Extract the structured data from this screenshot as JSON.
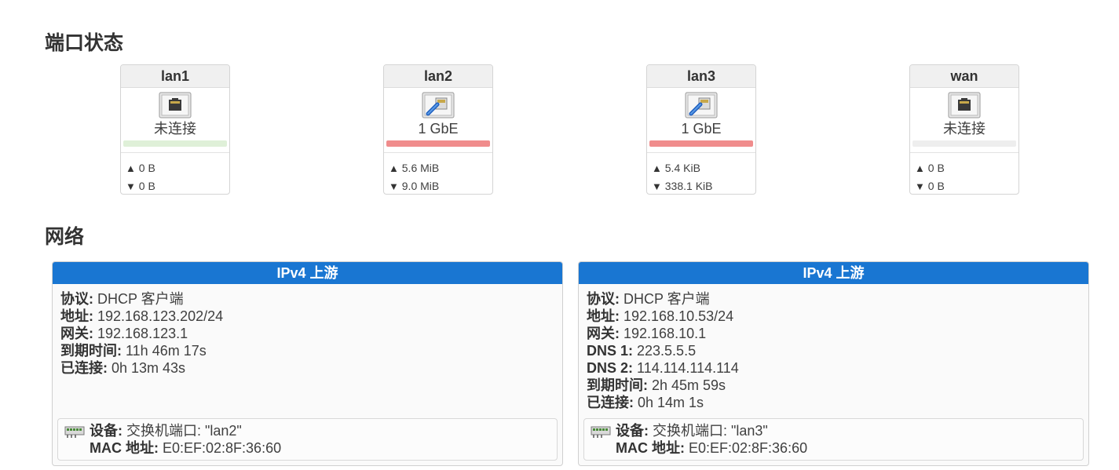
{
  "sections": {
    "port_status_title": "端口状态",
    "network_title": "网络"
  },
  "ports": [
    {
      "name": "lan1",
      "status": "未连接",
      "connected": false,
      "tx": "0 B",
      "rx": "0 B",
      "bar_color": "#dff0d8"
    },
    {
      "name": "lan2",
      "status": "1 GbE",
      "connected": true,
      "tx": "5.6 MiB",
      "rx": "9.0 MiB",
      "bar_color": "#f08c8c"
    },
    {
      "name": "lan3",
      "status": "1 GbE",
      "connected": true,
      "tx": "5.4 KiB",
      "rx": "338.1 KiB",
      "bar_color": "#f08c8c"
    },
    {
      "name": "wan",
      "status": "未连接",
      "connected": false,
      "tx": "0 B",
      "rx": "0 B",
      "bar_color": "#eeeeee"
    }
  ],
  "arrows": {
    "up": "▲",
    "down": "▼"
  },
  "networks": [
    {
      "title": "IPv4 上游",
      "fields": [
        {
          "label": "协议:",
          "value": "DHCP 客户端"
        },
        {
          "label": "地址:",
          "value": "192.168.123.202/24"
        },
        {
          "label": "网关:",
          "value": "192.168.123.1"
        },
        {
          "label": "到期时间:",
          "value": "11h 46m 17s"
        },
        {
          "label": "已连接:",
          "value": "0h 13m 43s"
        }
      ],
      "device": {
        "label": "设备:",
        "value": "交换机端口: \"lan2\"",
        "mac_label": "MAC 地址:",
        "mac": "E0:EF:02:8F:36:60"
      }
    },
    {
      "title": "IPv4 上游",
      "fields": [
        {
          "label": "协议:",
          "value": "DHCP 客户端"
        },
        {
          "label": "地址:",
          "value": "192.168.10.53/24"
        },
        {
          "label": "网关:",
          "value": "192.168.10.1"
        },
        {
          "label": "DNS 1:",
          "value": "223.5.5.5"
        },
        {
          "label": "DNS 2:",
          "value": "114.114.114.114"
        },
        {
          "label": "到期时间:",
          "value": "2h 45m 59s"
        },
        {
          "label": "已连接:",
          "value": "0h 14m 1s"
        }
      ],
      "device": {
        "label": "设备:",
        "value": "交换机端口: \"lan3\"",
        "mac_label": "MAC 地址:",
        "mac": "E0:EF:02:8F:36:60"
      }
    }
  ],
  "colors": {
    "accent": "#1976d2"
  }
}
